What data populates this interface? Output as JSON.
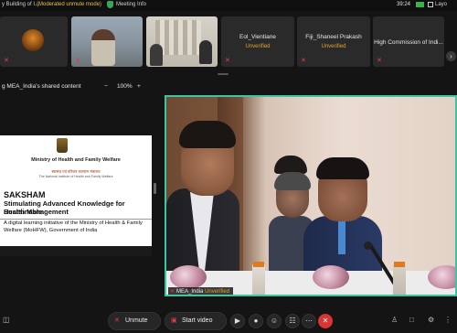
{
  "topbar": {
    "title": "y Building of I...",
    "status": "(Moderated unmute mode)",
    "meeting_info": "Meeting Info",
    "time": "39:24",
    "layout": "Layo"
  },
  "participants": [
    {
      "name": "Eol_Vientiane",
      "status": "Unverified"
    },
    {
      "name": "Fiji_Shaneel Prakash",
      "status": "Unverified"
    },
    {
      "name": "High Commission of Indi...",
      "status": ""
    }
  ],
  "share": {
    "label": "g MEA_India's shared content",
    "zoom_minus": "−",
    "zoom": "100%",
    "zoom_plus": "+"
  },
  "slide": {
    "ministry": "Ministry of Health and Family Welfare",
    "ministry_hindi": "स्वास्थ्य एवं परिवार कल्याण मंत्रालय",
    "ministry_sub": "The National Institute of Health and Family Welfare",
    "saksham": "SAKSHAM",
    "subtitle_1": "Stimulating Advanced Knowledge for Sustainable",
    "subtitle_2": "Health Management",
    "description": "A digital learning initiative of the Ministry of Health & Family Welfare (MoHFW), Government of India"
  },
  "video": {
    "name": "MEA_India",
    "status": "Unverified"
  },
  "controls": {
    "unmute": "Unmute",
    "start_video": "Start video"
  },
  "colors": {
    "active_speaker_border": "#3bc5a0",
    "unverified": "#e0a52a",
    "end_call": "#d83535",
    "muted_mic": "#e04040"
  }
}
